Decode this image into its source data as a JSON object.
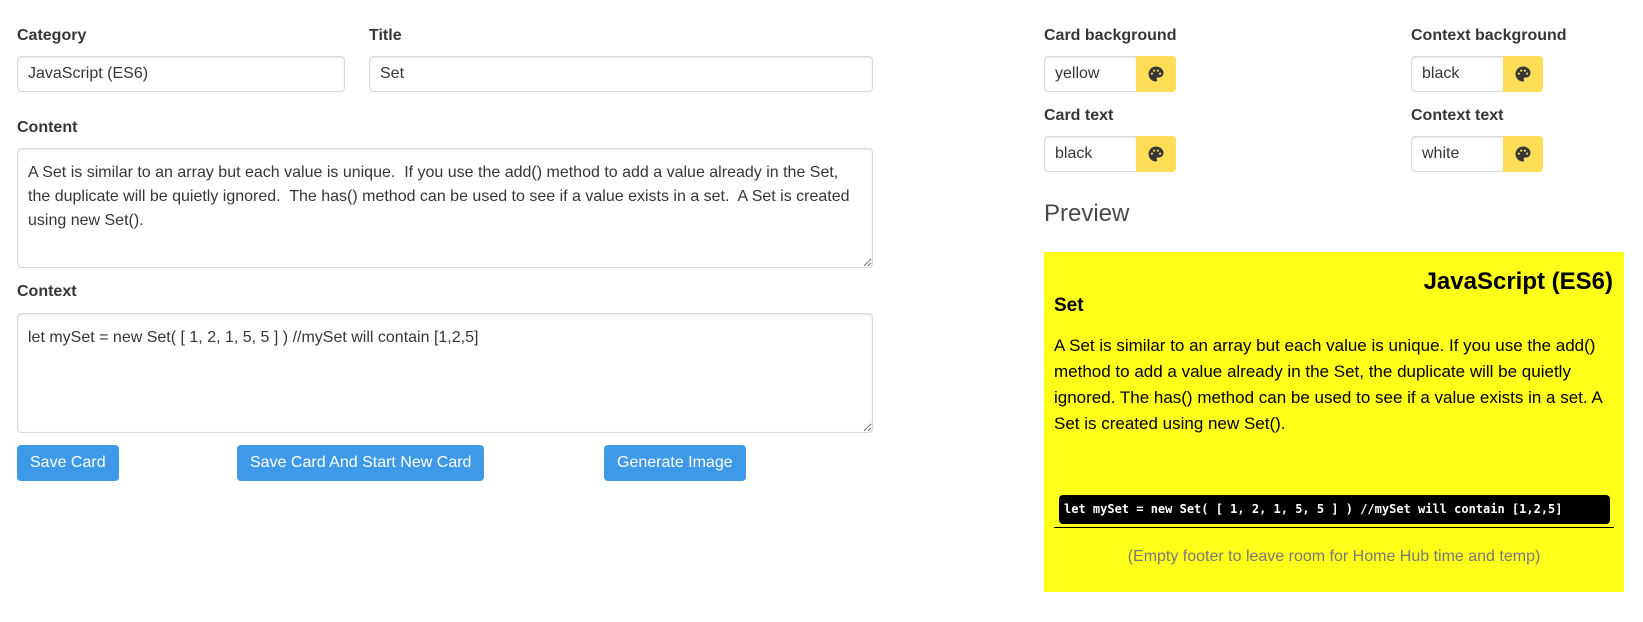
{
  "form": {
    "category_label": "Category",
    "category_value": "JavaScript (ES6)",
    "title_label": "Title",
    "title_value": "Set",
    "content_label": "Content",
    "content_value": "A Set is similar to an array but each value is unique.  If you use the add() method to add a value already in the Set, the duplicate will be quietly ignored.  The has() method can be used to see if a value exists in a set.  A Set is created using new Set().",
    "context_label": "Context",
    "context_value": "let mySet = new Set( [ 1, 2, 1, 5, 5 ] ) //mySet will contain [1,2,5]"
  },
  "buttons": {
    "save": "Save Card",
    "save_new": "Save Card And Start New Card",
    "generate": "Generate Image"
  },
  "colors": {
    "card_background_label": "Card background",
    "card_background_value": "yellow",
    "context_background_label": "Context background",
    "context_background_value": "black",
    "card_text_label": "Card text",
    "card_text_value": "black",
    "context_text_label": "Context text",
    "context_text_value": "white",
    "palette_icon": "palette-icon",
    "palette_button_color": "#ffdd57",
    "button_color": "#3e9ae8",
    "card_bg_color": "#ffff1a"
  },
  "preview": {
    "heading": "Preview",
    "category": "JavaScript (ES6)",
    "title": "Set",
    "content": "A Set is similar to an array but each value is unique. If you use the add() method to add a value already in the Set, the duplicate will be quietly ignored. The has() method can be used to see if a value exists in a set. A Set is created using new Set().",
    "context": "let mySet = new Set( [ 1, 2, 1, 5, 5 ] ) //mySet will contain [1,2,5]",
    "footer": "(Empty footer to leave room for Home Hub time and temp)"
  }
}
